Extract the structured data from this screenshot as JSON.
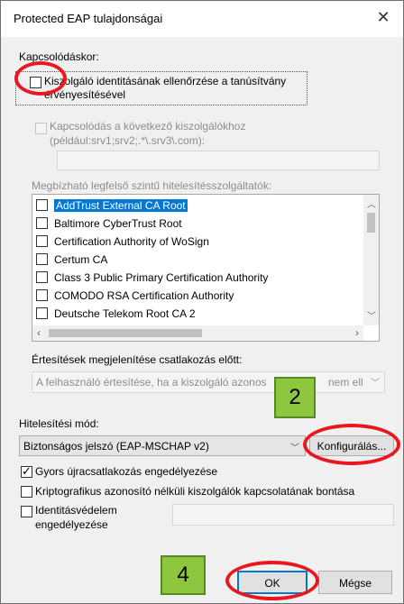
{
  "window": {
    "title": "Protected EAP tulajdonságai",
    "close_glyph": "✕"
  },
  "connect_section": {
    "heading": "Kapcsolódáskor:",
    "verify_checkbox_line1": "Kiszolgáló identitásának ellenőrzése a tanúsítvány",
    "verify_checkbox_line2": "érvényesítésével",
    "connect_servers_line1": "Kapcsolódás a következő kiszolgálókhoz",
    "connect_servers_line2": "(például:srv1;srv2;.*\\.srv3\\.com):",
    "servers_input_value": ""
  },
  "trusted_ca": {
    "label": "Megbízható legfelső szintű hitelesítésszolgáltatók:",
    "items": [
      {
        "label": "AddTrust External CA Root",
        "selected": true
      },
      {
        "label": "Baltimore CyberTrust Root"
      },
      {
        "label": "Certification Authority of WoSign"
      },
      {
        "label": "Certum CA"
      },
      {
        "label": "Class 3 Public Primary Certification Authority"
      },
      {
        "label": "COMODO RSA Certification Authority"
      },
      {
        "label": "Deutsche Telekom Root CA 2"
      }
    ]
  },
  "notifications": {
    "label": "Értesítések megjelenítése csatlakozás előtt:",
    "value_left": "A felhasználó értesítése, ha a kiszolgáló azonos",
    "value_right": "nem ell"
  },
  "auth": {
    "label": "Hitelesítési mód:",
    "method": "Biztonságos jelszó (EAP-MSCHAP v2)",
    "configure_button": "Konfigurálás..."
  },
  "options": {
    "fast_reconnect": "Gyors újracsatlakozás engedélyezése",
    "disconnect_no_crypto": "Kriptografikus azonosító nélküli kiszolgálók kapcsolatának bontása",
    "identity_privacy_line1": "Identitásvédelem",
    "identity_privacy_line2": "engedélyezése",
    "identity_value": ""
  },
  "buttons": {
    "ok": "OK",
    "cancel": "Mégse"
  },
  "annotations": {
    "badge_configure": "2",
    "badge_ok": "4"
  },
  "colors": {
    "highlight": "#0078d7",
    "annotation_circle": "#e8181e",
    "annotation_badge": "#8dc63f"
  }
}
